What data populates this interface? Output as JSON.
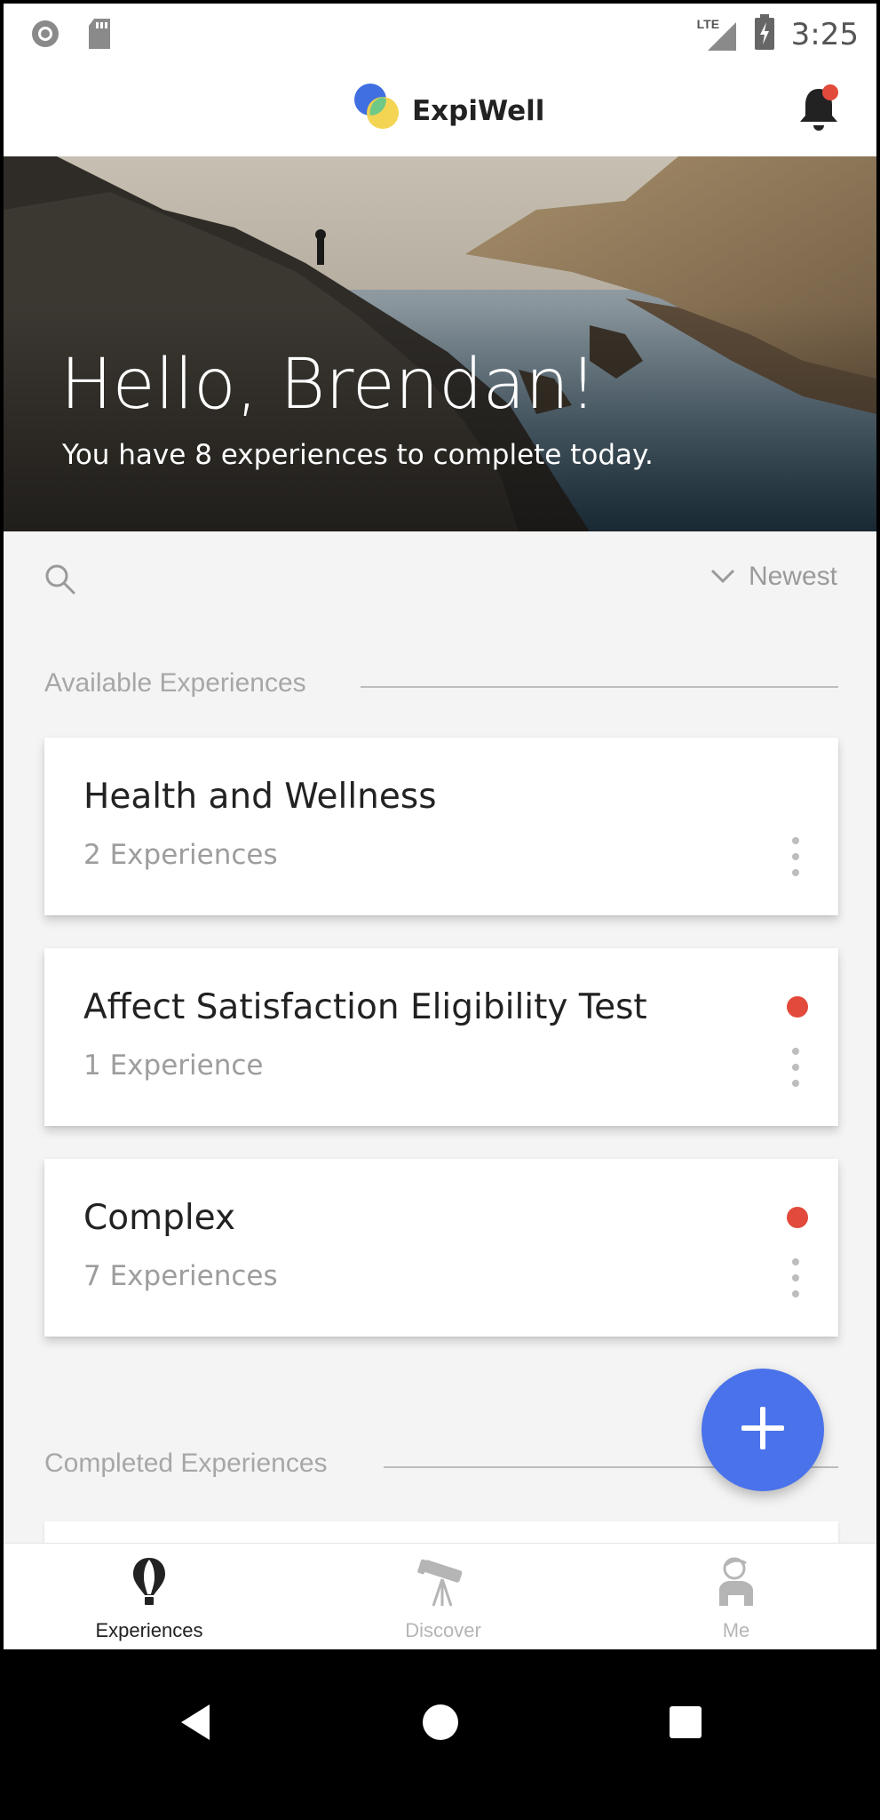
{
  "status_bar": {
    "time": "3:25",
    "network": "LTE",
    "icons": [
      "circle-notification-icon",
      "sd-card-icon",
      "signal-icon",
      "battery-charging-icon"
    ]
  },
  "app_bar": {
    "title": "ExpiWell",
    "icons": [
      "expiwell-logo-icon",
      "bell-icon"
    ],
    "bell_badge": true
  },
  "hero": {
    "greeting": "Hello, Brendan!",
    "subtitle": "You have 8 experiences to complete today."
  },
  "toolbar": {
    "sort_label": "Newest",
    "icons": [
      "search-icon",
      "chevron-down-icon"
    ]
  },
  "sections": {
    "available": "Available Experiences",
    "completed": "Completed Experiences"
  },
  "cards": [
    {
      "title": "Health and Wellness",
      "subtitle": "2 Experiences",
      "unread": false
    },
    {
      "title": "Affect Satisfaction Eligibility Test",
      "subtitle": "1 Experience",
      "unread": true
    },
    {
      "title": "Complex",
      "subtitle": "7 Experiences",
      "unread": true
    }
  ],
  "fab": {
    "icon": "plus-icon"
  },
  "bottom_nav": {
    "items": [
      {
        "label": "Experiences",
        "icon": "hot-air-balloon-icon",
        "active": true
      },
      {
        "label": "Discover",
        "icon": "telescope-icon",
        "active": false
      },
      {
        "label": "Me",
        "icon": "person-icon",
        "active": false
      }
    ]
  },
  "colors": {
    "accent_blue": "#4a72ea",
    "unread_dot": "#e24a3b",
    "logo_blue": "#3f6fe0",
    "logo_green": "#63c88c",
    "logo_yellow": "#f2d34a"
  }
}
